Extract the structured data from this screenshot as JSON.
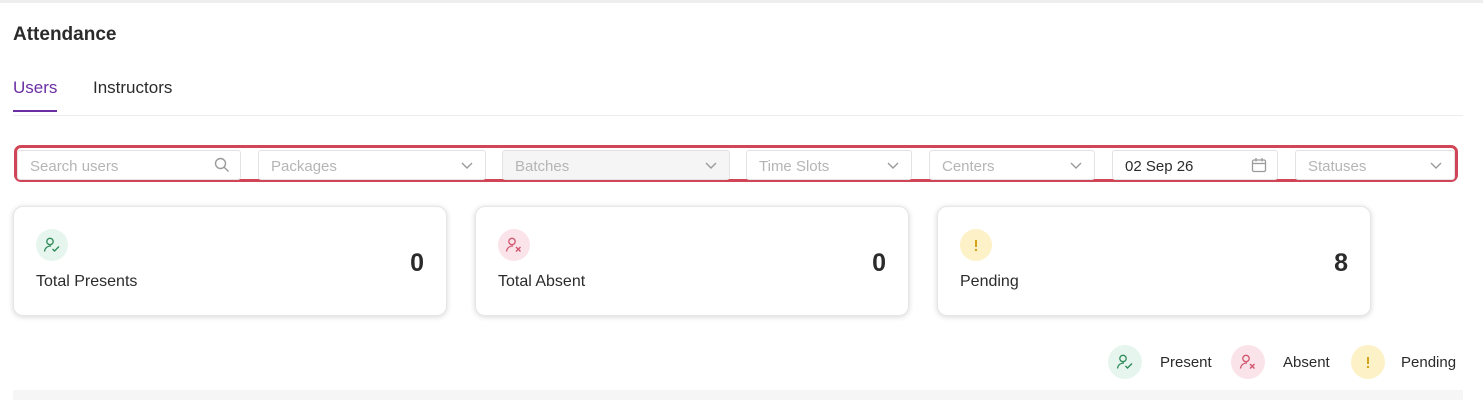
{
  "page": {
    "title": "Attendance"
  },
  "tabs": [
    {
      "label": "Users",
      "active": true
    },
    {
      "label": "Instructors",
      "active": false
    }
  ],
  "filters": {
    "search": {
      "placeholder": "Search users",
      "value": ""
    },
    "packages": {
      "placeholder": "Packages"
    },
    "batches": {
      "placeholder": "Batches"
    },
    "time_slots": {
      "placeholder": "Time Slots"
    },
    "centers": {
      "placeholder": "Centers"
    },
    "date": {
      "value": "02 Sep 26"
    },
    "statuses": {
      "placeholder": "Statuses"
    }
  },
  "cards": [
    {
      "label": "Total Presents",
      "value": "0",
      "icon": "user-check-icon",
      "color": "#2f8a5a"
    },
    {
      "label": "Total Absent",
      "value": "0",
      "icon": "user-x-icon",
      "color": "#d1566f"
    },
    {
      "label": "Pending",
      "value": "8",
      "icon": "exclamation-icon",
      "color": "#d3a21b"
    }
  ],
  "legend": {
    "present": "Present",
    "absent": "Absent",
    "pending": "Pending"
  },
  "colors": {
    "accent": "#6b2fa3",
    "highlight_border": "#d14657"
  }
}
